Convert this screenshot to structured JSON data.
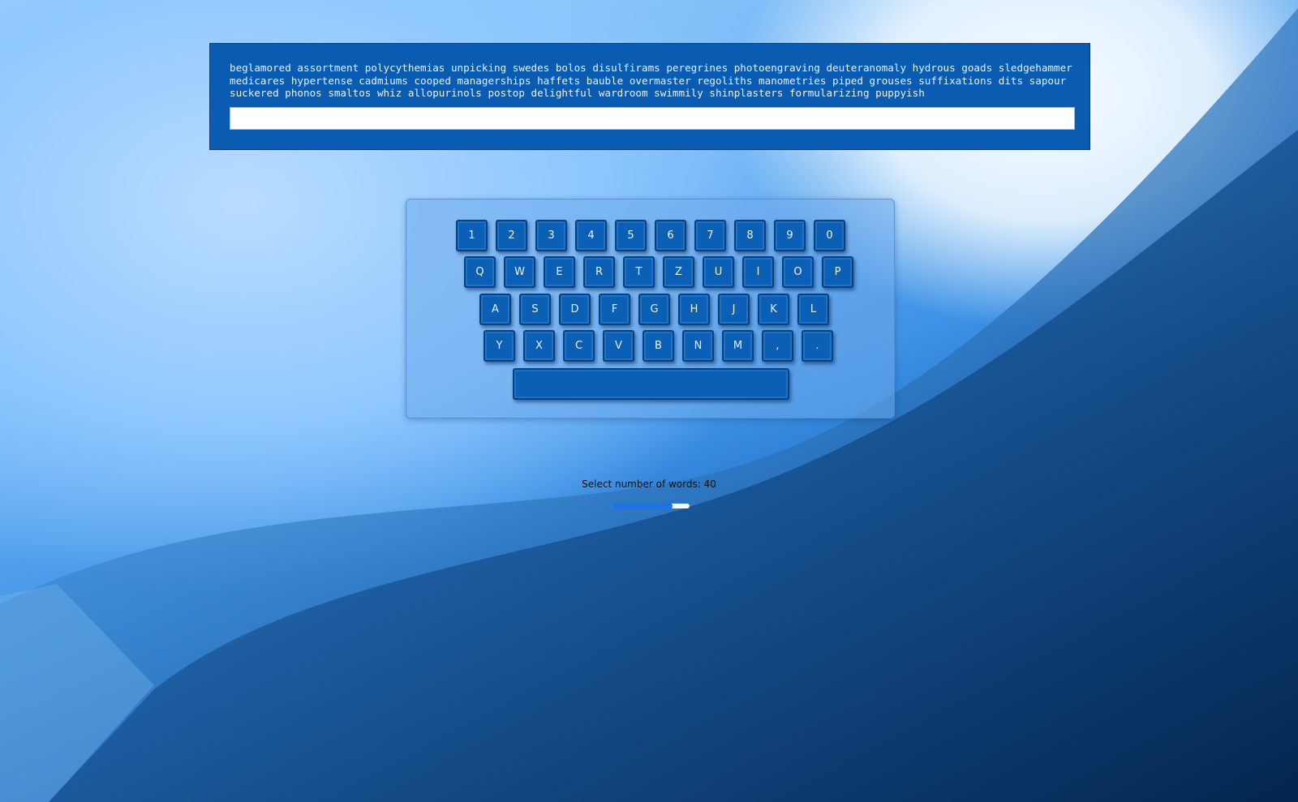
{
  "prompt": {
    "text": "beglamored assortment polycythemias unpicking swedes bolos disulfirams peregrines photoengraving deuteranomaly hydrous goads sledgehammer medicares hypertense cadmiums cooped managerships haffets bauble overmaster regoliths manometries piped grouses suffixations dits sapour suckered phonos smaltos whiz allopurinols postop delightful wardroom swimmily shinplasters formularizing puppyish",
    "input_value": "",
    "input_placeholder": ""
  },
  "keyboard": {
    "row1": [
      "1",
      "2",
      "3",
      "4",
      "5",
      "6",
      "7",
      "8",
      "9",
      "0"
    ],
    "row2": [
      "Q",
      "W",
      "E",
      "R",
      "T",
      "Z",
      "U",
      "I",
      "O",
      "P"
    ],
    "row3": [
      "A",
      "S",
      "D",
      "F",
      "G",
      "H",
      "J",
      "K",
      "L"
    ],
    "row4": [
      "Y",
      "X",
      "C",
      "V",
      "B",
      "N",
      "M",
      ",",
      "."
    ],
    "space_label": ""
  },
  "word_selector": {
    "label": "Select number of words: 40",
    "value": 40,
    "min": 0,
    "max": 55
  },
  "colors": {
    "panel": "#0a5cb3",
    "key": "#0b5fb5",
    "slider_accent": "#1a73e8"
  }
}
